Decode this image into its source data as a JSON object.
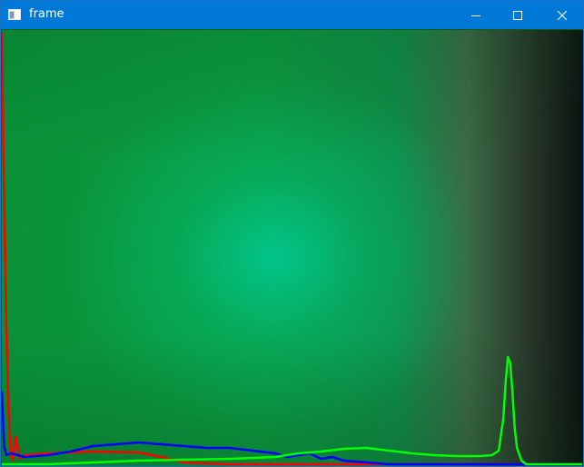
{
  "window": {
    "title": "frame",
    "icons": {
      "app": "window-icon",
      "minimize": "minimize-icon",
      "maximize": "maximize-icon",
      "close": "close-icon"
    },
    "colors": {
      "titlebar": "#0078d7",
      "title_text": "#ffffff"
    }
  },
  "histogram": {
    "bins": 256,
    "value_max": 480,
    "channels": [
      {
        "name": "",
        "color": "#ff0000",
        "points": [
          [
            0,
            475
          ],
          [
            1,
            300
          ],
          [
            2,
            150
          ],
          [
            3,
            60
          ],
          [
            4,
            12
          ],
          [
            5,
            4
          ],
          [
            6,
            30
          ],
          [
            8,
            6
          ],
          [
            10,
            10
          ],
          [
            20,
            12
          ],
          [
            40,
            14
          ],
          [
            60,
            13
          ],
          [
            70,
            8
          ],
          [
            80,
            2
          ],
          [
            100,
            0
          ],
          [
            255,
            0
          ]
        ]
      },
      {
        "name": "",
        "color": "#0000ff",
        "points": [
          [
            0,
            80
          ],
          [
            1,
            20
          ],
          [
            2,
            10
          ],
          [
            4,
            12
          ],
          [
            10,
            8
          ],
          [
            20,
            10
          ],
          [
            30,
            14
          ],
          [
            40,
            20
          ],
          [
            50,
            22
          ],
          [
            60,
            24
          ],
          [
            70,
            22
          ],
          [
            80,
            20
          ],
          [
            90,
            18
          ],
          [
            100,
            18
          ],
          [
            110,
            15
          ],
          [
            120,
            12
          ],
          [
            125,
            8
          ],
          [
            130,
            10
          ],
          [
            135,
            12
          ],
          [
            140,
            6
          ],
          [
            145,
            8
          ],
          [
            150,
            4
          ],
          [
            155,
            3
          ],
          [
            160,
            2
          ],
          [
            170,
            0
          ],
          [
            255,
            0
          ]
        ]
      },
      {
        "name": "",
        "color": "#00ff00",
        "points": [
          [
            0,
            0
          ],
          [
            20,
            0
          ],
          [
            40,
            2
          ],
          [
            60,
            4
          ],
          [
            80,
            5
          ],
          [
            100,
            6
          ],
          [
            120,
            8
          ],
          [
            130,
            12
          ],
          [
            140,
            14
          ],
          [
            150,
            17
          ],
          [
            160,
            18
          ],
          [
            170,
            15
          ],
          [
            180,
            12
          ],
          [
            190,
            10
          ],
          [
            200,
            9
          ],
          [
            210,
            9
          ],
          [
            215,
            10
          ],
          [
            218,
            15
          ],
          [
            220,
            50
          ],
          [
            221,
            90
          ],
          [
            222,
            118
          ],
          [
            223,
            112
          ],
          [
            224,
            80
          ],
          [
            225,
            40
          ],
          [
            226,
            18
          ],
          [
            228,
            4
          ],
          [
            230,
            0
          ],
          [
            255,
            0
          ]
        ]
      }
    ]
  }
}
